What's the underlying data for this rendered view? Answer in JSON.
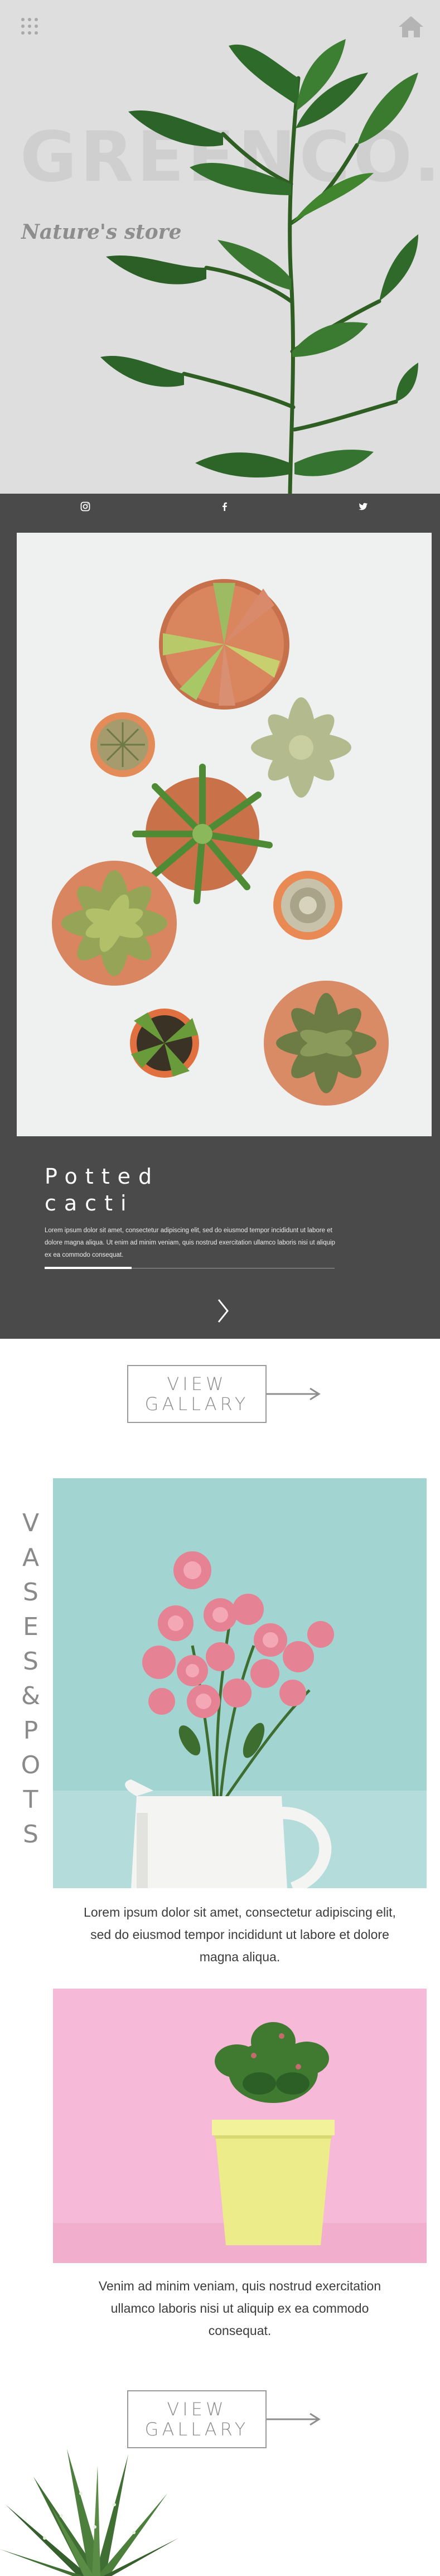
{
  "hero": {
    "brand": "GREENCO.",
    "tagline": "Nature's store",
    "icons": {
      "menu": "grid-dots-icon",
      "home": "home-icon"
    },
    "colors": {
      "background": "#dedede",
      "title": "#cfcfcf",
      "tagline": "#8d8d8d"
    }
  },
  "social": {
    "icons": [
      "instagram-icon",
      "facebook-icon",
      "twitter-icon"
    ]
  },
  "card": {
    "title_line1": "Potted",
    "title_line2": "cacti",
    "text": "Lorem ipsum dolor sit amet, consectetur adipiscing elit, sed do eiusmod tempor incididunt ut labore et dolore magna aliqua. Ut enim ad minim veniam, quis nostrud exercitation ullamco laboris nisi ut aliquip ex ea commodo consequat.",
    "progress": 0.3,
    "next_icon": "chevron-right-icon",
    "colors": {
      "background": "#4a4a4a",
      "text": "#ffffff"
    }
  },
  "gallery_buttons": [
    {
      "line1": "VIEW",
      "line2": "GALLARY"
    },
    {
      "line1": "VIEW",
      "line2": "GALLARY"
    }
  ],
  "vases": {
    "label_letters": [
      "V",
      "A",
      "S",
      "E",
      "S",
      "&",
      "P",
      "O",
      "T",
      "S"
    ],
    "para1": "Lorem ipsum dolor sit amet, consectetur adipiscing elit, sed do eiusmod tempor incididunt ut labore et dolore magna aliqua.",
    "para2": "Venim ad minim veniam, quis nostrud exercitation ullamco laboris nisi ut aliquip ex ea commodo consequat.",
    "colors": {
      "vase_bg": "#9fd2d0",
      "pink_bg": "#f5b9d6"
    }
  }
}
